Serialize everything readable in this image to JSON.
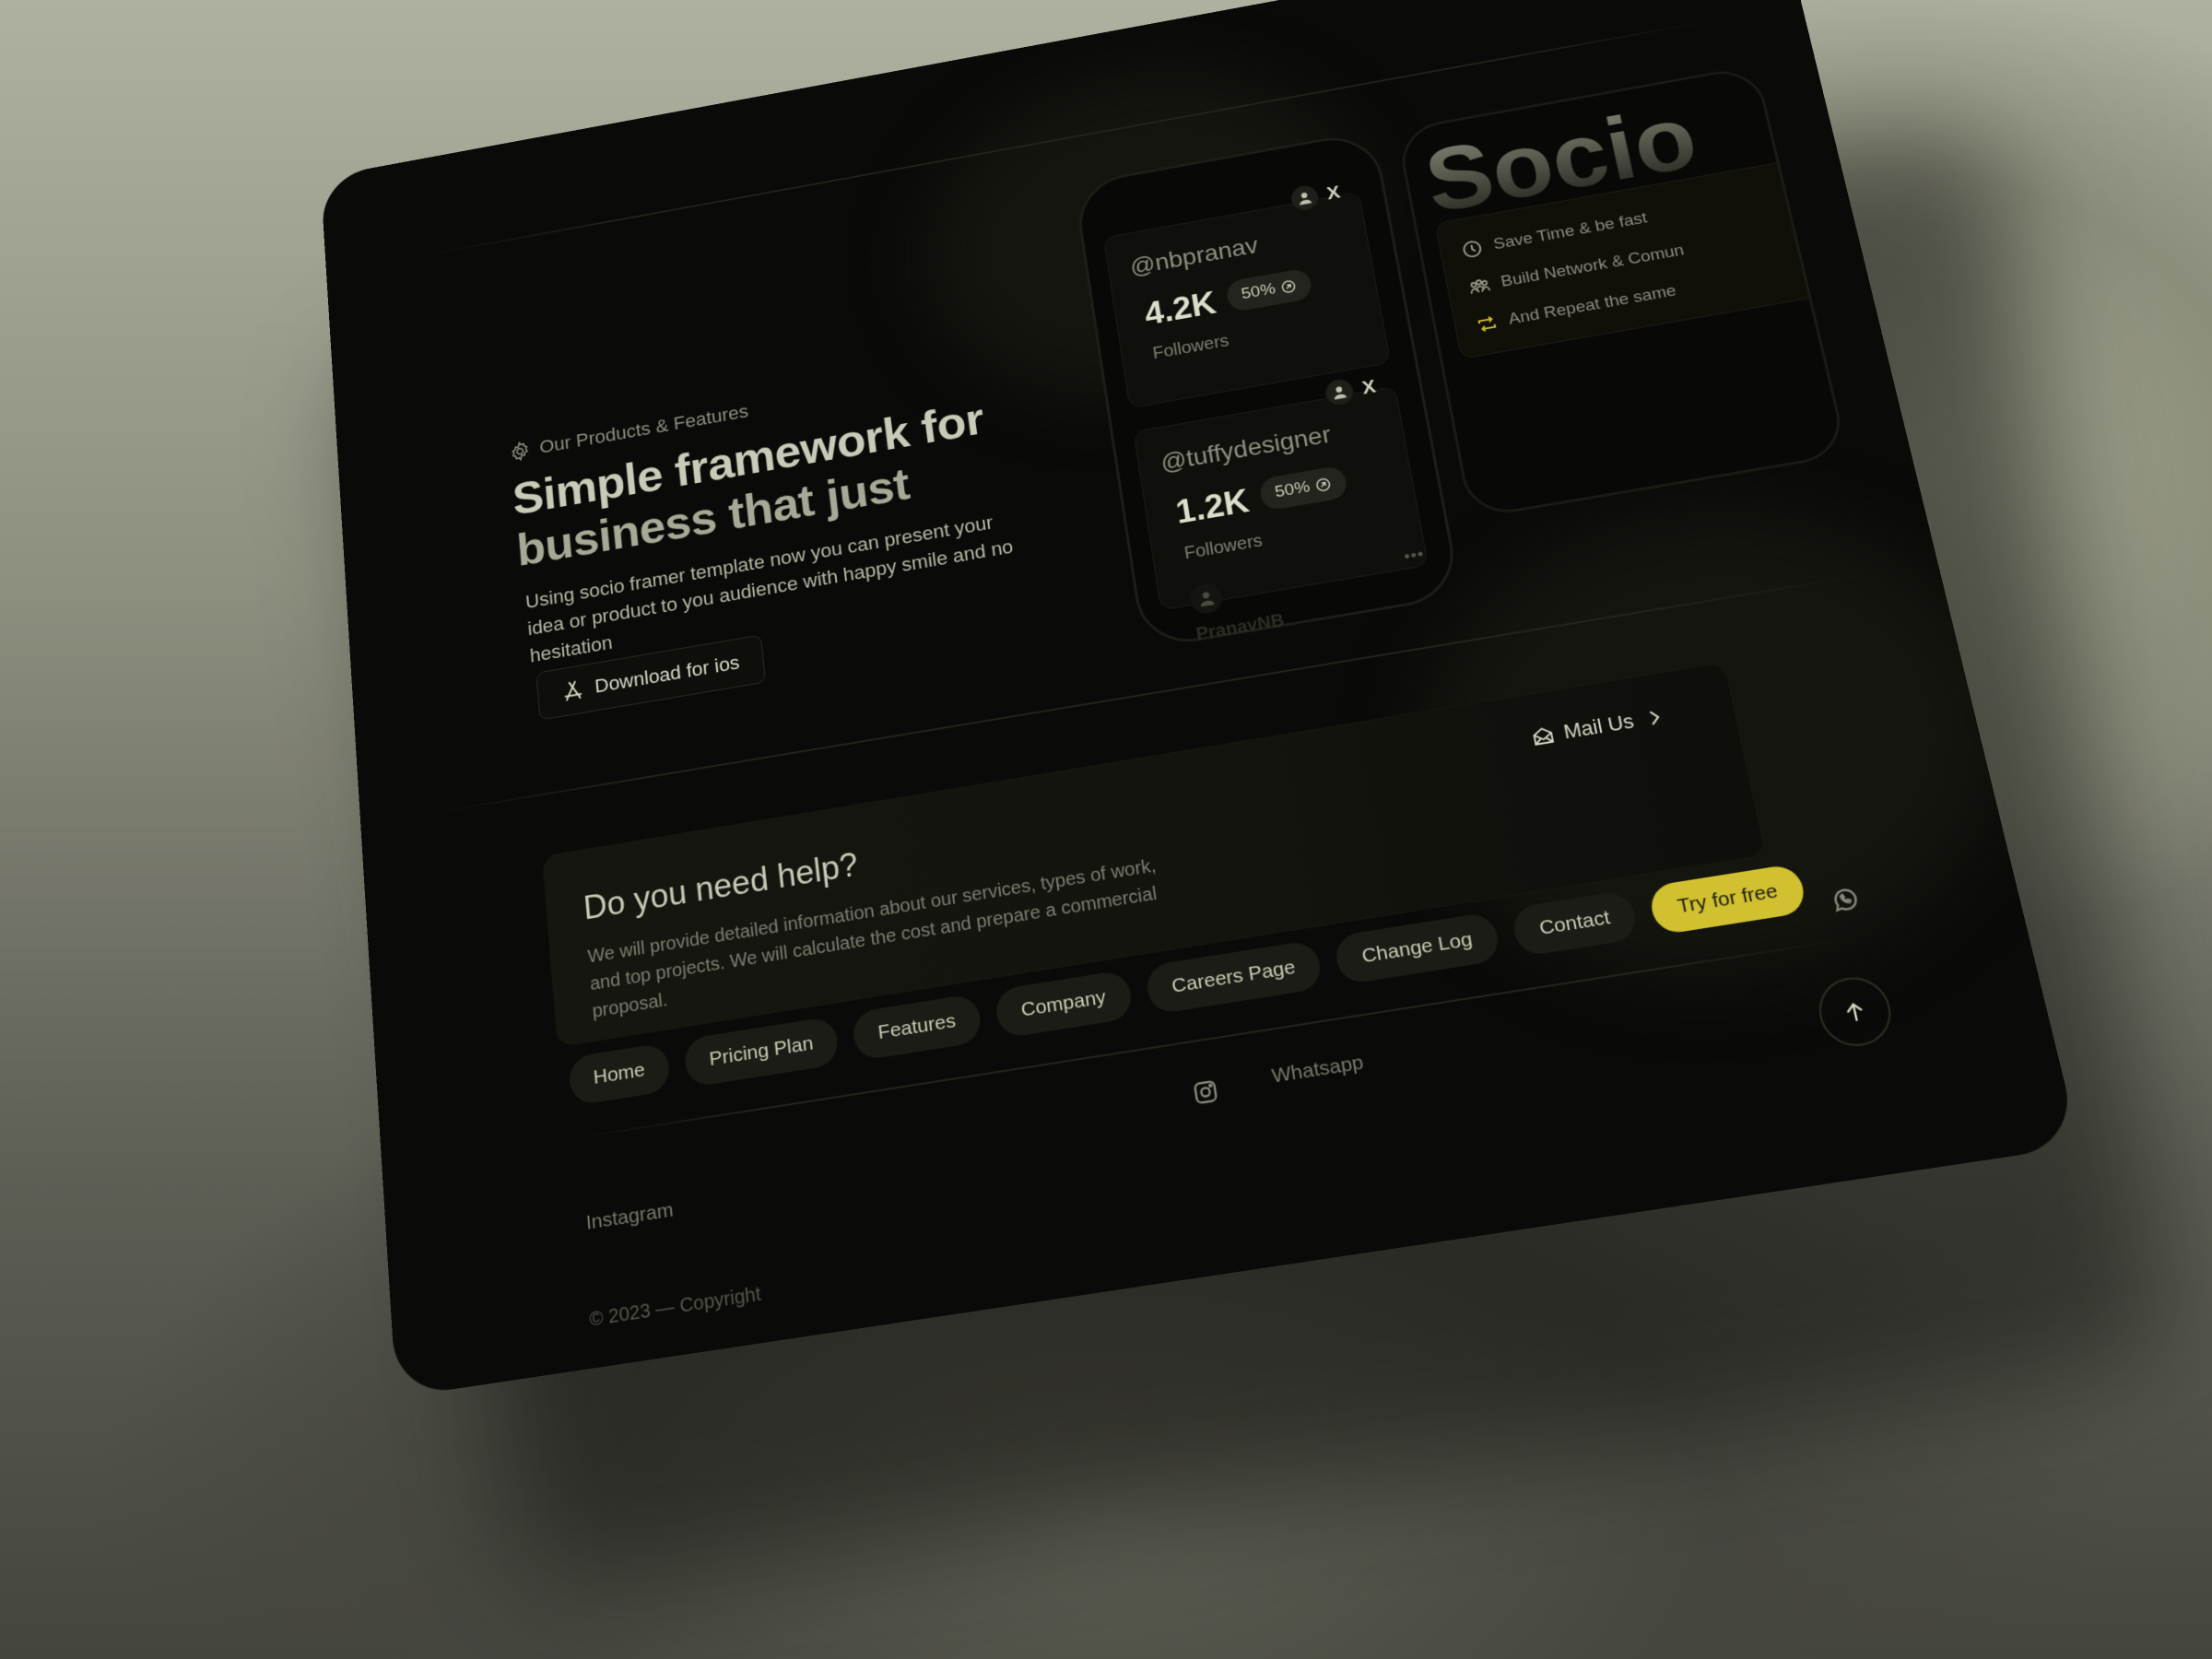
{
  "hero": {
    "eyebrow": "Our Products & Features",
    "eyebrow_icon": "gear-icon",
    "title_line1": "Simple framework for",
    "title_line2": "business that just",
    "description": "Using socio framer template now  you can present your idea or product to you audience with happy smile and no hesitation",
    "download_button": "Download for ios",
    "download_icon": "app-store-icon"
  },
  "phone": {
    "cards": [
      {
        "handle": "@nbpranav",
        "count": "4.2K",
        "change": "50%",
        "label": "Followers",
        "platform": "X"
      },
      {
        "handle": "@tuffydesigner",
        "count": "1.2K",
        "change": "50%",
        "label": "Followers",
        "platform": "X"
      }
    ],
    "more": "•••",
    "profile_name": "PranavNB"
  },
  "socio": {
    "brand": "Socio",
    "features": [
      {
        "icon": "clock-icon",
        "label": "Save Time & be fast"
      },
      {
        "icon": "people-icon",
        "label": "Build Network & Comun"
      },
      {
        "icon": "repeat-icon",
        "label": "And Repeat the same"
      }
    ]
  },
  "help": {
    "title": "Do you need help?",
    "description": "We will provide detailed information about our services, types of work, and top projects. We will calculate the cost and prepare a commercial proposal.",
    "mail_label": "Mail Us"
  },
  "nav": {
    "items": [
      "Home",
      "Pricing Plan",
      "Features",
      "Company",
      "Careers Page",
      "Change Log",
      "Contact"
    ],
    "cta": "Try for free"
  },
  "social": {
    "instagram": "Instagram",
    "whatsapp": "Whatsapp"
  },
  "footer": {
    "copyright": "© 2023 — Copyright"
  },
  "colors": {
    "accent": "#d1c02f",
    "panel_bg": "#0a0a08",
    "text_primary": "#d8dac8"
  }
}
